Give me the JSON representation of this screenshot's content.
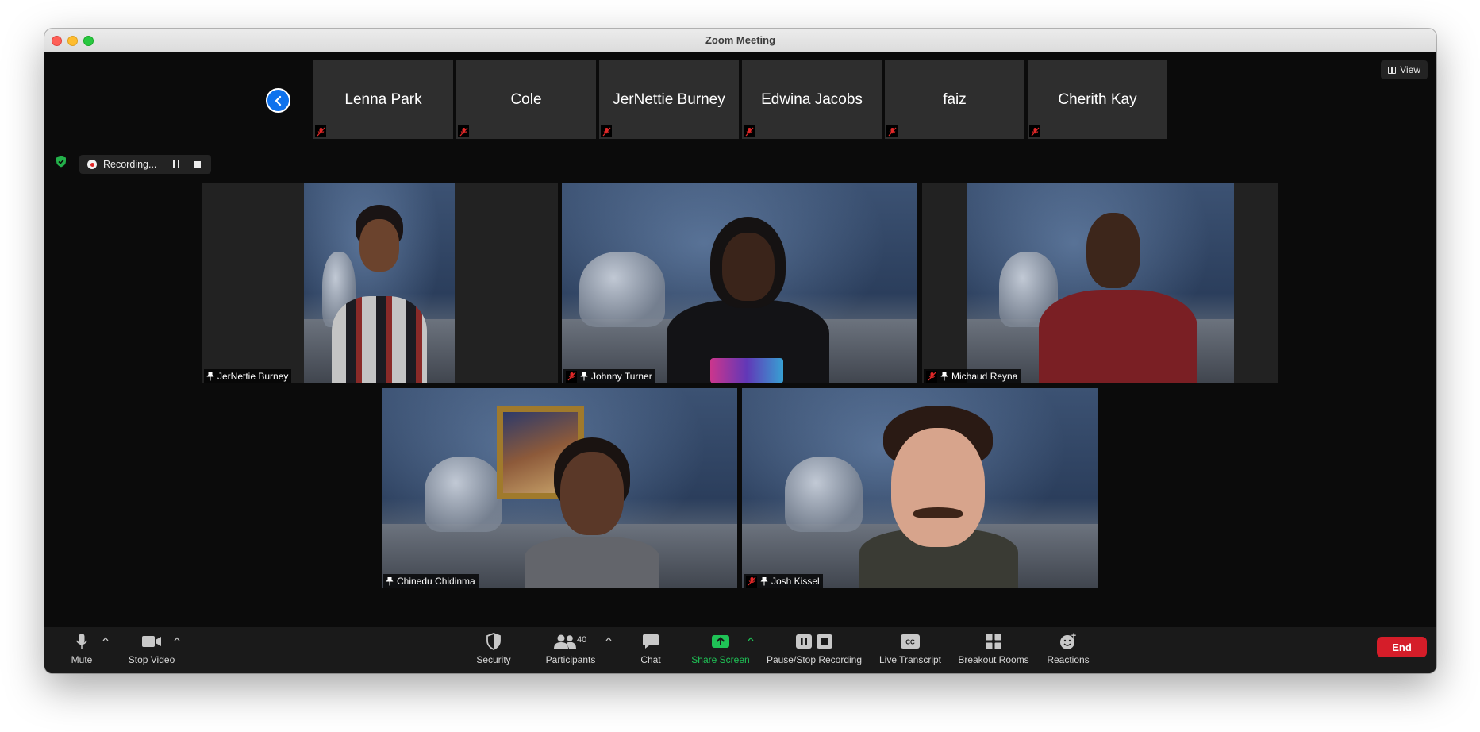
{
  "window": {
    "title": "Zoom Meeting"
  },
  "view_button": {
    "label": "View"
  },
  "strip": {
    "back_icon": "chevron-left-icon",
    "participants": [
      {
        "name": "Lenna Park"
      },
      {
        "name": "Cole"
      },
      {
        "name": "JerNettie Burney"
      },
      {
        "name": "Edwina Jacobs"
      },
      {
        "name": "faiz"
      },
      {
        "name": "Cherith Kay"
      }
    ]
  },
  "recording": {
    "label": "Recording..."
  },
  "gallery": [
    {
      "name": "JerNettie Burney",
      "muted": false,
      "pinned": true
    },
    {
      "name": "Johnny Turner",
      "muted": true,
      "pinned": true
    },
    {
      "name": "Michaud Reyna",
      "muted": true,
      "pinned": true
    },
    {
      "name": "Chinedu Chidinma",
      "muted": false,
      "pinned": true
    },
    {
      "name": "Josh Kissel",
      "muted": true,
      "pinned": true
    }
  ],
  "toolbar": {
    "mute": "Mute",
    "stop_video": "Stop Video",
    "security": "Security",
    "participants": "Participants",
    "participants_count": "40",
    "chat": "Chat",
    "share_screen": "Share Screen",
    "pause_stop_recording": "Pause/Stop Recording",
    "live_transcript": "Live Transcript",
    "breakout_rooms": "Breakout Rooms",
    "reactions": "Reactions",
    "end": "End"
  },
  "colors": {
    "accent_blue": "#0e72ed",
    "share_green": "#1fc256",
    "end_red": "#d51d29",
    "muted_red": "#e02828"
  }
}
